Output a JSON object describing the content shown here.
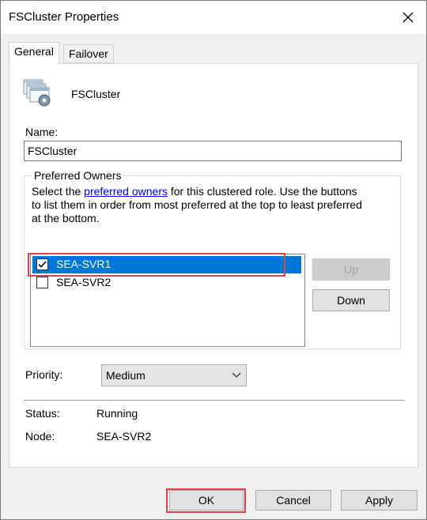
{
  "window": {
    "title": "FSCluster Properties"
  },
  "tabs": [
    {
      "label": "General",
      "active": true
    },
    {
      "label": "Failover",
      "active": false
    }
  ],
  "general": {
    "role_name": "FSCluster",
    "role_icon": "cluster-role-icon",
    "name_label": "Name:",
    "name_value": "FSCluster",
    "preferred_owners": {
      "legend": "Preferred Owners",
      "desc_prefix": "Select the ",
      "link_text": "preferred owners",
      "desc_line1_suffix": " for this clustered role. Use the buttons",
      "desc_line2": "to list them in order from most preferred at the top to least preferred",
      "desc_line3": "at the bottom.",
      "owners": [
        {
          "name": "SEA-SVR1",
          "checked": true,
          "selected": true
        },
        {
          "name": "SEA-SVR2",
          "checked": false,
          "selected": false
        }
      ],
      "up_label": "Up",
      "down_label": "Down"
    },
    "priority_label": "Priority:",
    "priority_value": "Medium",
    "status_label": "Status:",
    "status_value": "Running",
    "node_label": "Node:",
    "node_value": "SEA-SVR2"
  },
  "buttons": {
    "ok": "OK",
    "cancel": "Cancel",
    "apply": "Apply"
  },
  "colors": {
    "selection": "#0078d7",
    "highlight": "#e0424a",
    "link": "#0000ee"
  }
}
